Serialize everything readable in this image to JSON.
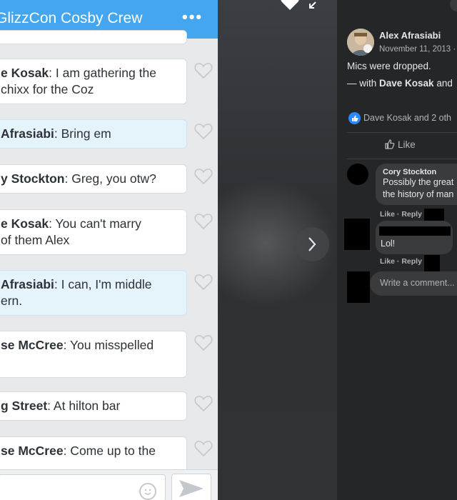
{
  "chat": {
    "title": "GlizzCon Cosby Crew",
    "more_label": "•••",
    "messages": [
      {
        "sender": "e Kosak",
        "sep": ":",
        "text": " I am gathering the",
        "text2": "chixx for the Coz"
      },
      {
        "sender": "Afrasiabi",
        "sep": ":",
        "text": " Bring em",
        "text2": ""
      },
      {
        "sender": "y Stockton",
        "sep": ":",
        "text": " Greg, you otw?",
        "text2": ""
      },
      {
        "sender": "e Kosak",
        "sep": ":",
        "text": " You can't marry",
        "text2": "of them Alex"
      },
      {
        "sender": "Afrasiabi",
        "sep": ":",
        "text": " I can, I'm middle",
        "text2": "ern."
      },
      {
        "sender": "se McCree",
        "sep": ":",
        "text": " You misspelled",
        "text2": ""
      },
      {
        "sender": "g Street",
        "sep": ":",
        "text": " At hilton bar",
        "text2": ""
      },
      {
        "sender": "se McCree",
        "sep": ":",
        "text": " Come up to the",
        "text2": ""
      }
    ]
  },
  "post": {
    "author": "Alex Afrasiabi",
    "date": "November 11, 2013 ·",
    "text": "Mics were dropped.",
    "with_prefix": "— with ",
    "with_name": "Dave Kosak",
    "with_suffix": " and",
    "reactions": "Dave Kosak and 2 oth",
    "like_label": "Like",
    "comments": [
      {
        "name": "Cory Stockton",
        "line1": "Possibly the great",
        "line2": "the history of man",
        "actions": "Like · Reply"
      },
      {
        "name": "",
        "line1": "Lol!",
        "line2": "",
        "actions": "Like · Reply"
      }
    ],
    "write_placeholder": "Write a comment..."
  },
  "colors": {
    "chat_header": "#43a6ee",
    "chat_bg": "#e7e9ea",
    "fb_panel": "#252627",
    "fb_like_blue": "#2d88ff"
  },
  "icons": [
    "heart-icon",
    "expand-icon",
    "chevron-right-icon",
    "thumbs-up-icon",
    "emoji-icon",
    "send-icon"
  ]
}
